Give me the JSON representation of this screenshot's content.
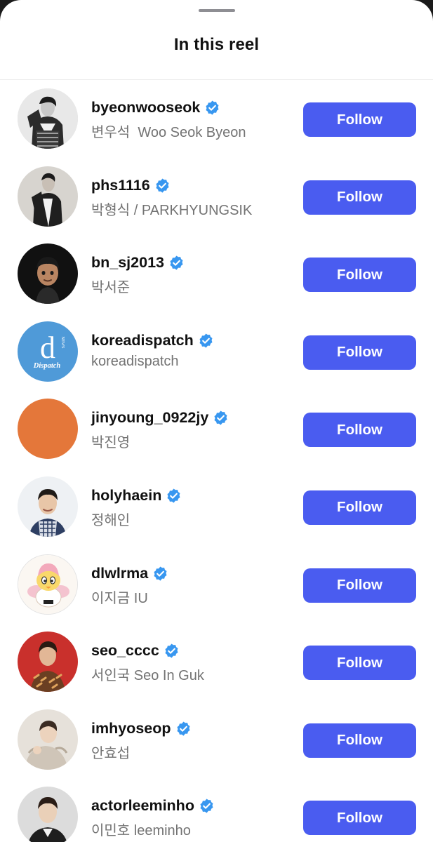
{
  "sheet": {
    "title": "In this reel"
  },
  "accounts": [
    {
      "username": "byeonwooseok",
      "full_name": "변우석  Woo Seok Byeon",
      "verified": true,
      "button_label": "Follow"
    },
    {
      "username": "phs1116",
      "full_name": "박형식 / PARKHYUNGSIK",
      "verified": true,
      "button_label": "Follow"
    },
    {
      "username": "bn_sj2013",
      "full_name": "박서준",
      "verified": true,
      "button_label": "Follow"
    },
    {
      "username": "koreadispatch",
      "full_name": "koreadispatch",
      "verified": true,
      "button_label": "Follow",
      "avatar_text": "Dispatch"
    },
    {
      "username": "jinyoung_0922jy",
      "full_name": "박진영",
      "verified": true,
      "button_label": "Follow"
    },
    {
      "username": "holyhaein",
      "full_name": "정해인",
      "verified": true,
      "button_label": "Follow"
    },
    {
      "username": "dlwlrma",
      "full_name": "이지금 IU",
      "verified": true,
      "button_label": "Follow"
    },
    {
      "username": "seo_cccc",
      "full_name": "서인국 Seo In Guk",
      "verified": true,
      "button_label": "Follow"
    },
    {
      "username": "imhyoseop",
      "full_name": "안효섭",
      "verified": true,
      "button_label": "Follow"
    },
    {
      "username": "actorleeminho",
      "full_name": "이민호 leeminho",
      "verified": true,
      "button_label": "Follow"
    }
  ],
  "colors": {
    "follow_button": "#4a5cf0",
    "verified_badge": "#3897f0",
    "secondary_text": "#737373"
  }
}
